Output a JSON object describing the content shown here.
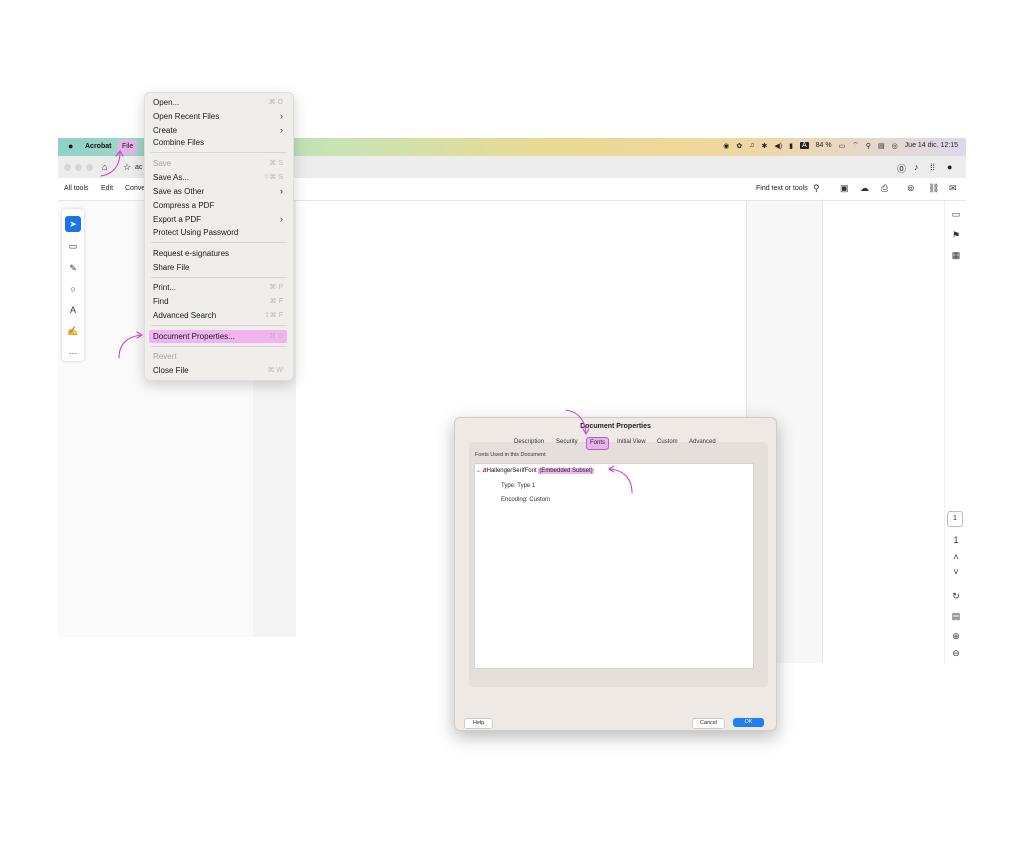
{
  "menubar": {
    "app_name": "Acrobat",
    "file_label": "File",
    "battery": "84 %",
    "date_time": "Jue 14 dic.  12:15"
  },
  "toolbar": {
    "all_tools": "All tools",
    "edit": "Edit",
    "convert": "Conve",
    "tab_fragment": "ac",
    "find": "Find text or tools"
  },
  "file_menu": {
    "items": [
      {
        "label": "Open...",
        "shortcut": "⌘ O"
      },
      {
        "label": "Open Recent Files",
        "submenu": true
      },
      {
        "label": "Create",
        "submenu": true
      },
      {
        "label": "Combine Files"
      },
      {
        "label": "Save",
        "shortcut": "⌘ S",
        "disabled": true
      },
      {
        "label": "Save As...",
        "shortcut": "⇧⌘ S"
      },
      {
        "label": "Save as Other",
        "submenu": true
      },
      {
        "label": "Compress a PDF"
      },
      {
        "label": "Export a PDF",
        "submenu": true
      },
      {
        "label": "Protect Using Password"
      },
      {
        "label": "Request e-signatures"
      },
      {
        "label": "Share File"
      },
      {
        "label": "Print...",
        "shortcut": "⌘ P"
      },
      {
        "label": "Find",
        "shortcut": "⌘ F"
      },
      {
        "label": "Advanced Search",
        "shortcut": "⇧⌘ F"
      },
      {
        "label": "Document Properties...",
        "shortcut": "⌘ D",
        "highlighted": true
      },
      {
        "label": "Revert",
        "disabled": true
      },
      {
        "label": "Close File",
        "shortcut": "⌘ W"
      }
    ]
  },
  "dialog": {
    "title": "Document Properties",
    "tabs": [
      "Description",
      "Security",
      "Fonts",
      "Initial View",
      "Custom",
      "Advanced"
    ],
    "active_tab": "Fonts",
    "fonts_label": "Fonts Used in this Document",
    "font_name": "HallengerSerifFont",
    "font_subset": "(Embedded Subset)",
    "type": "Type: Type 1",
    "encoding": "Encoding: Custom",
    "help": "Help",
    "cancel": "Cancel",
    "ok": "OK"
  },
  "page_nav": {
    "current": "1",
    "total": "1"
  },
  "colors": {
    "highlight": "#f2b4f0",
    "accent": "#1f7ef2",
    "annotation": "#d13fd6"
  }
}
